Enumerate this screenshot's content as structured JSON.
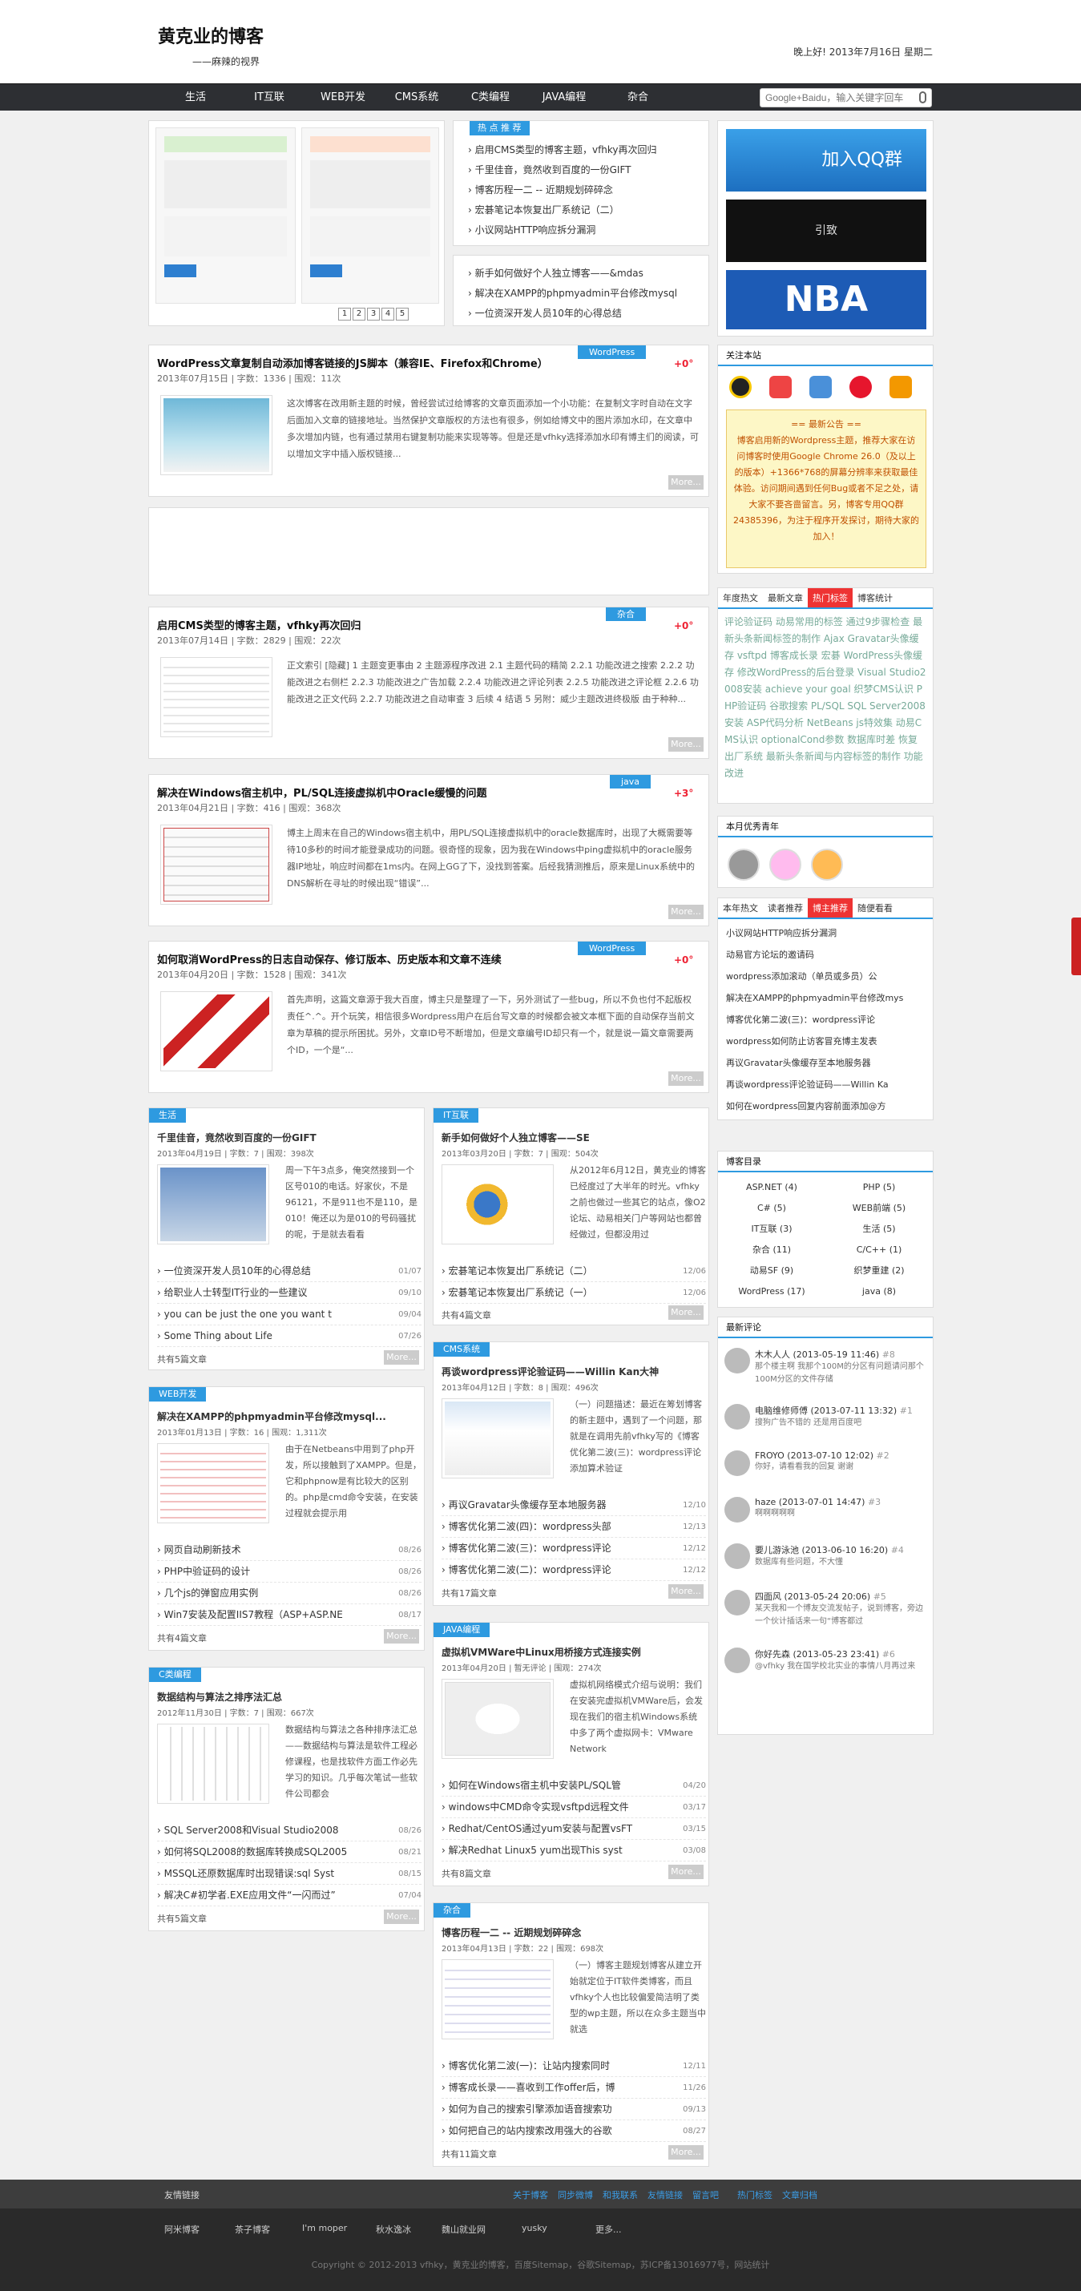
{
  "header": {
    "logo": "黄克业的博客",
    "slogan": "——麻辣的视界",
    "greeting": "晚上好! 2013年7月16日 星期二"
  },
  "nav": [
    "生活",
    "IT互联",
    "WEB开发",
    "CMS系统",
    "C类编程",
    "JAVA编程",
    "杂合"
  ],
  "search": {
    "placeholder": "Google+Baidu，输入关键字回车"
  },
  "slider": {
    "pages": [
      "1",
      "2",
      "3",
      "4",
      "5"
    ]
  },
  "hot": {
    "label": "热 点 推 荐",
    "items": [
      "启用CMS类型的博客主题，vfhky再次回归",
      "千里佳音，竟然收到百度的一份GIFT",
      "博客历程一二 -- 近期规划碎碎念",
      "宏碁笔记本恢复出厂系统记（二）",
      "小议网站HTTP响应拆分漏洞"
    ]
  },
  "hot2": [
    "新手如何做好个人独立博客——&mdas",
    "解决在XAMPP的phpmyadmin平台修改mysql",
    "一位资深开发人员10年的心得总结"
  ],
  "articles": [
    {
      "tag": "WordPress",
      "hot": "+0°",
      "title": "WordPress文章复制自动添加博客链接的JS脚本（兼容IE、Firefox和Chrome）",
      "meta": "2013年07月15日 | 字数：1336 | 围观：11次",
      "excerpt": "这次博客在改用新主题的时候，曾经尝试过给博客的文章页面添加一个小功能：在复制文字时自动在文字后面加入文章的链接地址。当然保护文章版权的方法也有很多，例如给博文中的图片添加水印，在文章中多次增加内链，也有通过禁用右键复制功能来实现等等。但是还是vfhky选择添加水印有博主们的阅读，可以增加文字中插入版权链接..."
    },
    {
      "tag": "杂合",
      "hot": "+0°",
      "title": "启用CMS类型的博客主题，vfhky再次回归",
      "meta": "2013年07月14日 | 字数：2829 | 围观：22次",
      "excerpt": "正文索引 [隐藏] 1 主题变更事由 2 主题源程序改进 2.1 主题代码的精简 2.2.1 功能改进之搜索 2.2.2 功能改进之右侧栏 2.2.3 功能改进之广告加载 2.2.4 功能改进之评论列表 2.2.5 功能改进之评论框 2.2.6 功能改进之正文代码 2.2.7 功能改进之自动审查 3 后续 4 结语 5 另附：威少主题改进终极版 由于种种..."
    },
    {
      "tag": "java",
      "hot": "+3°",
      "title": "解决在Windows宿主机中，PL/SQL连接虚拟机中Oracle缓慢的问题",
      "meta": "2013年04月21日 | 字数：416 | 围观：368次",
      "excerpt": "博主上周末在自己的Windows宿主机中，用PL/SQL连接虚拟机中的oracle数据库时，出现了大概需要等待10多秒的时间才能登录成功的问题。很奇怪的现象，因为我在Windows中ping虚拟机中的oracle服务器IP地址，响应时间都在1ms内。在网上GG了下，没找到答案。后经我猜测推后，原来是Linux系统中的DNS解析在寻址的时候出现“错误”..."
    },
    {
      "tag": "WordPress",
      "hot": "+0°",
      "title": "如何取消WordPress的日志自动保存、修订版本、历史版本和文章不连续",
      "meta": "2013年04月20日 | 字数：1528 | 围观：341次",
      "excerpt": "首先声明，这篇文章源于我大百度，博主只是整理了一下，另外测试了一些bug，所以不负也付不起版权责任^.^。开个玩笑，相信很多Wordpress用户在后台写文章的时候都会被文本框下面的自动保存当前文章为草稿的提示所困扰。另外，文章ID号不断增加，但是文章编号ID却只有一个，就是说一篇文章需要两个ID，一个是“..."
    }
  ],
  "boxes": [
    {
      "tag": "生活",
      "title": "千里佳音，竟然收到百度的一份GIFT",
      "meta": "2013年04月19日 | 字数：7 | 围观：398次",
      "excerpt": "周一下午3点多，俺突然接到一个区号010的电话。好家伙，不是96121，不是911也不是110，是010！俺还以为是010的号码骚扰的呢，于是就去看看",
      "list": [
        [
          "一位资深开发人员10年的心得总结",
          "01/07"
        ],
        [
          "给职业人士转型IT行业的一些建议",
          "09/10"
        ],
        [
          "you can be just the one you want t",
          "09/04"
        ],
        [
          "Some Thing about Life",
          "07/26"
        ]
      ],
      "foot": "共有5篇文章"
    },
    {
      "tag": "IT互联",
      "title": "新手如何做好个人独立博客——SE",
      "meta": "2013年03月20日 | 字数：7 | 围观：504次",
      "excerpt": "从2012年6月12日，黄克业的博客已经度过了大半年的时光。vfhky之前也做过一些其它的站点，像O2论坛、动易相关门户等网站也都曾经做过，但都没用过",
      "list": [
        [
          "宏碁笔记本恢复出厂系统记（二）",
          "12/06"
        ],
        [
          "宏碁笔记本恢复出厂系统记（一）",
          "12/06"
        ]
      ],
      "foot": "共有4篇文章"
    },
    {
      "tag": "WEB开发",
      "title": "解决在XAMPP的phpmyadmin平台修改mysql...",
      "meta": "2013年01月13日 | 字数：16 | 围观：1,311次",
      "excerpt": "由于在Netbeans中用到了php开发，所以接触到了XAMPP。但是，它和phpnow是有比较大的区别的。php是cmd命令安装，在安装过程就会提示用",
      "list": [
        [
          "网页自动刷新技术",
          "08/26"
        ],
        [
          "PHP中验证码的设计",
          "08/26"
        ],
        [
          "几个js的弹窗应用实例",
          "08/26"
        ],
        [
          "Win7安装及配置IIS7教程（ASP+ASP.NE",
          "08/17"
        ]
      ],
      "foot": "共有4篇文章"
    },
    {
      "tag": "CMS系统",
      "title": "再谈wordpress评论验证码——Willin Kan大神",
      "meta": "2013年04月12日 | 字数：8 | 围观：496次",
      "excerpt": "（一）问题描述：最近在筹划博客的新主题中，遇到了一个问题，那就是在调用先前vfhky写的《博客优化第二波(三)：wordpress评论添加算术验证",
      "list": [
        [
          "再议Gravatar头像缓存至本地服务器",
          "12/10"
        ],
        [
          "博客优化第二波(四)：wordpress头部",
          "12/13"
        ],
        [
          "博客优化第二波(三)：wordpress评论",
          "12/12"
        ],
        [
          "博客优化第二波(二)：wordpress评论",
          "12/12"
        ]
      ],
      "foot": "共有17篇文章"
    },
    {
      "tag": "C类编程",
      "title": "数据结构与算法之排序法汇总",
      "meta": "2012年11月30日 | 字数：7 | 围观：667次",
      "excerpt": "数据结构与算法之各种排序法汇总——数据结构与算法是软件工程必修课程，也是找软件方面工作必先学习的知识。几乎每次笔试一些软件公司都会",
      "list": [
        [
          "SQL Server2008和Visual Studio2008",
          "08/26"
        ],
        [
          "如何将SQL2008的数据库转换成SQL2005",
          "08/21"
        ],
        [
          "MSSQL还原数据库时出现错误:sql Syst",
          "08/15"
        ],
        [
          "解决C#初学者.EXE应用文件“一闪而过”",
          "07/04"
        ]
      ],
      "foot": "共有5篇文章"
    },
    {
      "tag": "JAVA编程",
      "title": "虚拟机VMWare中Linux用桥接方式连接实例",
      "meta": "2013年04月20日 | 暂无评论 | 围观：274次",
      "excerpt": "虚拟机网络模式介绍与说明：我们在安装完虚拟机VMWare后，会发现在我们的宿主机Windows系统中多了两个虚拟网卡：VMware Network",
      "list": [
        [
          "如何在Windows宿主机中安装PL/SQL管",
          "04/20"
        ],
        [
          "windows中CMD命令实现vsftpd远程文件",
          "03/17"
        ],
        [
          "Redhat/CentOS通过yum安装与配置vsFT",
          "03/15"
        ],
        [
          "解决Redhat Linux5 yum出现This syst",
          "03/08"
        ]
      ],
      "foot": "共有8篇文章"
    },
    {
      "tag": "杂合",
      "title": "博客历程一二 -- 近期规划碎碎念",
      "meta": "2013年04月13日 | 字数：22 | 围观：698次",
      "excerpt": "（一）博客主题规划博客从建立开始就定位于IT软件类博客，而且vfhky个人也比较偏爱简洁明了类型的wp主题，所以在众多主题当中就选",
      "list": [
        [
          "博客优化第二波(一)：让站内搜索同时",
          "12/11"
        ],
        [
          "博客成长录——喜收到工作offer后，博",
          "11/26"
        ],
        [
          "如何为自己的搜索引擎添加语音搜索功",
          "09/13"
        ],
        [
          "如何把自己的站内搜索改用强大的谷歌",
          "08/27"
        ]
      ],
      "foot": "共有11篇文章"
    }
  ],
  "right": {
    "ads": [
      "加入QQ群",
      "引致",
      "NBA"
    ],
    "follow": {
      "title": "关注本站",
      "notice_title": "== 最新公告 ==",
      "notice": "博客启用新的Wordpress主题，推荐大家在访问博客时使用Google Chrome 26.0（及以上的版本）+1366*768的屏幕分辨率来获取最佳体验。访问期间遇到任何Bug或者不足之处，请大家不要吝啬留言。另，博客专用QQ群24385396，为注于程序开发探讨，期待大家的加入！"
    },
    "tabs1": [
      "年度热文",
      "最新文章",
      "热门标签",
      "博客统计"
    ],
    "tags": "评论验证码 动易常用的标签 通过9步骤检查 最新头条新闻标签的制作 Ajax Gravatar头像缓存 vsftpd 博客成长录 宏碁 WordPress头像缓存 修改WordPress的后台登录 Visual Studio2008安装 achieve your goal 织梦CMS认识 PHP验证码 谷歌搜索 PL/SQL SQL Server2008安装 ASP代码分析 NetBeans js特效集 动易CMS认识 optionalCond参数 数据库时差 恢复出厂系统 最新头条新闻与内容标签的制作 功能改进",
    "visitors_title": "本月优秀青年",
    "tabs2": [
      "本年热文",
      "读者推荐",
      "博主推荐",
      "随便看看"
    ],
    "rec": [
      "小议网站HTTP响应拆分漏洞",
      "动易官方论坛的邀请码",
      "wordpress添加滚动（单员或多员）公",
      "解决在XAMPP的phpmyadmin平台修改mys",
      "博客优化第二波(三)：wordpress评论",
      "wordpress如何防止访客冒充博主发表",
      "再议Gravatar头像缓存至本地服务器",
      "再谈wordpress评论验证码——Willin Ka",
      "如何在wordpress回复内容前面添加@方"
    ],
    "cat_title": "博客目录",
    "cats": [
      [
        "ASP.NET (4)",
        "PHP (5)"
      ],
      [
        "C# (5)",
        "WEB前端 (5)"
      ],
      [
        "IT互联 (3)",
        "生活 (5)"
      ],
      [
        "杂合 (11)",
        "C/C++ (1)"
      ],
      [
        "动易SF (9)",
        "织梦重建 (2)"
      ],
      [
        "WordPress (17)",
        "java (8)"
      ]
    ],
    "cmt_title": "最新评论",
    "comments": [
      [
        "木木人人 (2013-05-19 11:46)",
        "#8",
        "那个楼主啊 我那个100M的分区有问题请问那个100M分区的文件存储"
      ],
      [
        "电脑维修师傅 (2013-07-11 13:32)",
        "#1",
        "搜狗广告不错的 还是用百度吧"
      ],
      [
        "FROYO (2013-07-10 12:02)",
        "#2",
        "你好，请看看我的回复 谢谢"
      ],
      [
        "haze (2013-07-01 14:47)",
        "#3",
        "啊啊啊啊啊"
      ],
      [
        "要儿游泳池 (2013-06-10 16:20)",
        "#4",
        "数据库有些问题，不大懂"
      ],
      [
        "四面风 (2013-05-24 20:06)",
        "#5",
        "某天我和一个博友交流发帖子，说到博客，旁边一个伙计插话来一句“博客都过"
      ],
      [
        "你好先森 (2013-05-23 23:41)",
        "#6",
        "@vfhky 我在国学校北实业的事情八月再过来"
      ]
    ]
  },
  "footer": {
    "links_title": "友情链接",
    "top_links": [
      "关于博客",
      "同步微博",
      "和我联系",
      "友情链接",
      "留言吧",
      "热门标签",
      "文章归档"
    ],
    "links": [
      "阿米博客",
      "茶子博客",
      "I'm moper",
      "秋水逸冰",
      "魏山就业网",
      "yusky",
      "更多..."
    ],
    "copyright": "Copyright © 2012-2013  vfhky，黄克业的博客，百度Sitemap，谷歌Sitemap，苏ICP备13016977号，网站统计"
  }
}
